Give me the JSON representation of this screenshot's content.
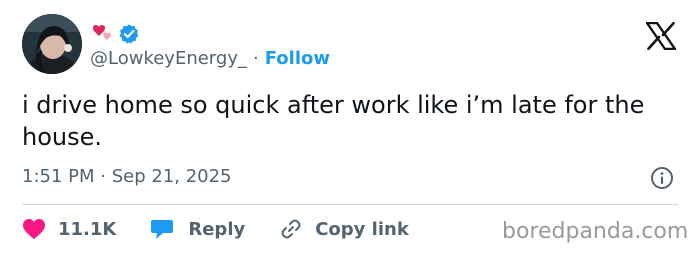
{
  "author": {
    "handle": "@LowkeyEnergy_",
    "separator": "·",
    "follow_label": "Follow",
    "emoji_icon": "two-hearts-icon",
    "verified_icon": "verified-badge-icon"
  },
  "platform_icon": "x-logo-icon",
  "tweet": {
    "text": "i drive home so quick after work like i’m late for the house."
  },
  "timestamp": "1:51 PM · Sep 21, 2025",
  "actions": {
    "likes": "11.1K",
    "reply_label": "Reply",
    "copy_link_label": "Copy link"
  },
  "watermark": "boredpanda.com",
  "colors": {
    "accent": "#1d9bf0",
    "like": "#f91880",
    "text": "#0f1419",
    "muted": "#536471"
  }
}
